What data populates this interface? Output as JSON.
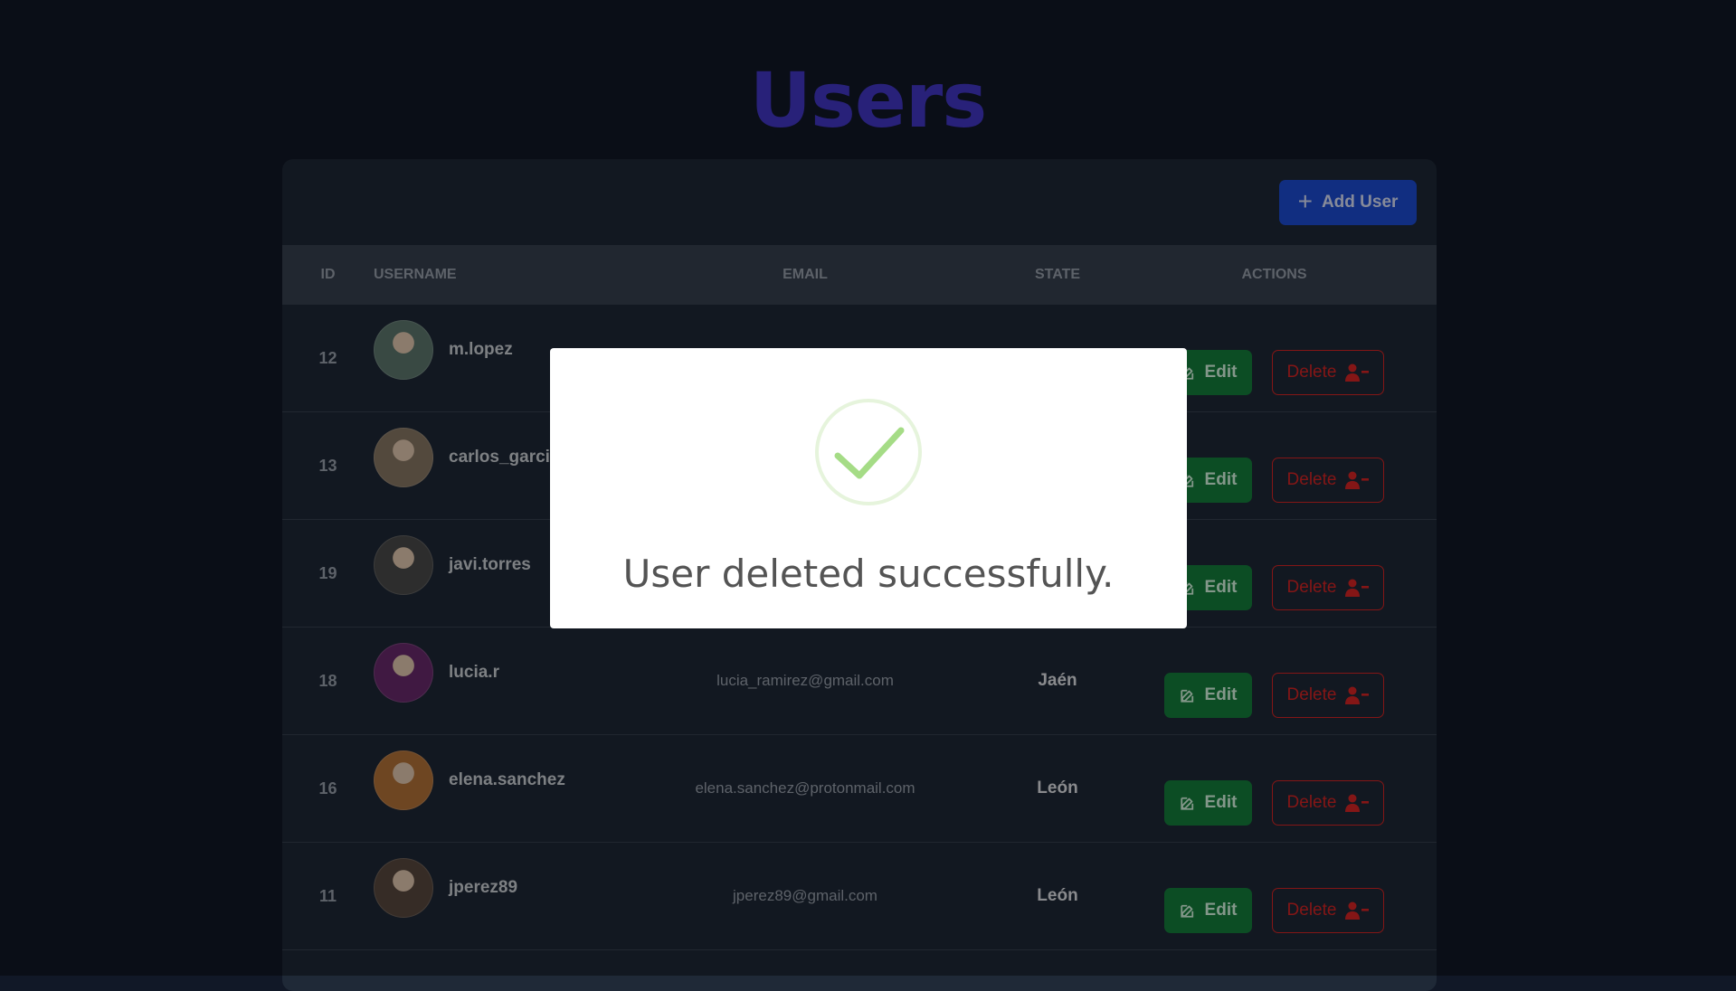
{
  "page": {
    "title": "Users"
  },
  "toolbar": {
    "add_label": "Add User"
  },
  "table": {
    "headers": {
      "id": "ID",
      "username": "USERNAME",
      "email": "EMAIL",
      "state": "STATE",
      "actions": "ACTIONS"
    },
    "rows": [
      {
        "id": "12",
        "username": "m.lopez",
        "email": "",
        "state": "",
        "avatar_color": "#5f7a70"
      },
      {
        "id": "13",
        "username": "carlos_garcia",
        "email": "",
        "state": "",
        "avatar_color": "#8a7a66"
      },
      {
        "id": "19",
        "username": "javi.torres",
        "email": "",
        "state": "",
        "avatar_color": "#4b4b4b"
      },
      {
        "id": "18",
        "username": "lucia.r",
        "email": "lucia_ramirez@gmail.com",
        "state": "Jaén",
        "avatar_color": "#6b2a6e"
      },
      {
        "id": "16",
        "username": "elena.sanchez",
        "email": "elena.sanchez@protonmail.com",
        "state": "León",
        "avatar_color": "#b8753a"
      },
      {
        "id": "11",
        "username": "jperez89",
        "email": "jperez89@gmail.com",
        "state": "León",
        "avatar_color": "#5a4a40"
      }
    ],
    "edit_label": "Edit",
    "delete_label": "Delete"
  },
  "modal": {
    "message": "User deleted successfully."
  },
  "colors": {
    "title": "#4338ca",
    "add_button": "#1d4ed8",
    "edit_button": "#15803d",
    "delete": "#dc2626",
    "success": "#a5dc86"
  }
}
